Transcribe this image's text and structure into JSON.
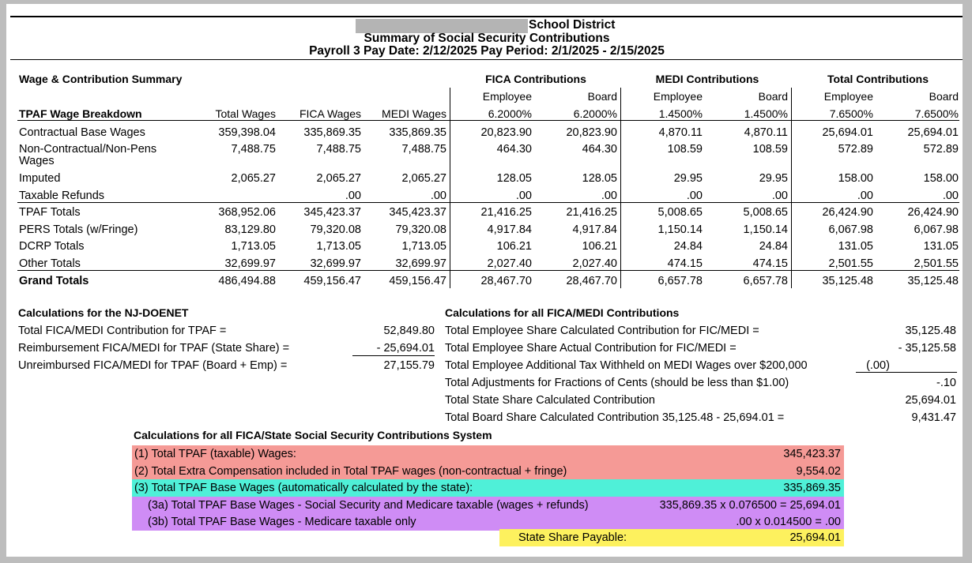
{
  "header": {
    "district_label": "School District",
    "title": "Summary of Social Security Contributions",
    "subtitle": "Payroll 3 Pay Date: 2/12/2025  Pay Period: 2/1/2025 - 2/15/2025"
  },
  "summary": {
    "section_title": "Wage & Contribution Summary",
    "group_fica": "FICA Contributions",
    "group_medi": "MEDI Contributions",
    "group_total": "Total Contributions",
    "sub_labels": [
      "Employee",
      "Board",
      "Employee",
      "Board",
      "Employee",
      "Board"
    ],
    "columns": [
      "TPAF Wage Breakdown",
      "Total Wages",
      "FICA Wages",
      "MEDI Wages",
      "6.2000%",
      "6.2000%",
      "1.4500%",
      "1.4500%",
      "7.6500%",
      "7.6500%"
    ],
    "rows": [
      {
        "label": "Contractual Base Wages",
        "v": [
          "359,398.04",
          "335,869.35",
          "335,869.35",
          "20,823.90",
          "20,823.90",
          "4,870.11",
          "4,870.11",
          "25,694.01",
          "25,694.01"
        ]
      },
      {
        "label": "Non-Contractual/Non-Pens",
        "label2": "Wages",
        "v": [
          "7,488.75",
          "7,488.75",
          "7,488.75",
          "464.30",
          "464.30",
          "108.59",
          "108.59",
          "572.89",
          "572.89"
        ]
      },
      {
        "label": "Imputed",
        "v": [
          "2,065.27",
          "2,065.27",
          "2,065.27",
          "128.05",
          "128.05",
          "29.95",
          "29.95",
          "158.00",
          "158.00"
        ]
      },
      {
        "label": "Taxable Refunds",
        "v": [
          "",
          ".00",
          ".00",
          ".00",
          ".00",
          ".00",
          ".00",
          ".00",
          ".00"
        ]
      },
      {
        "label": "TPAF Totals",
        "v": [
          "368,952.06",
          "345,423.37",
          "345,423.37",
          "21,416.25",
          "21,416.25",
          "5,008.65",
          "5,008.65",
          "26,424.90",
          "26,424.90"
        ]
      },
      {
        "label": "PERS Totals (w/Fringe)",
        "v": [
          "83,129.80",
          "79,320.08",
          "79,320.08",
          "4,917.84",
          "4,917.84",
          "1,150.14",
          "1,150.14",
          "6,067.98",
          "6,067.98"
        ]
      },
      {
        "label": "DCRP Totals",
        "v": [
          "1,713.05",
          "1,713.05",
          "1,713.05",
          "106.21",
          "106.21",
          "24.84",
          "24.84",
          "131.05",
          "131.05"
        ]
      },
      {
        "label": "Other Totals",
        "v": [
          "32,699.97",
          "32,699.97",
          "32,699.97",
          "2,027.40",
          "2,027.40",
          "474.15",
          "474.15",
          "2,501.55",
          "2,501.55"
        ]
      },
      {
        "label": "Grand Totals",
        "v": [
          "486,494.88",
          "459,156.47",
          "459,156.47",
          "28,467.70",
          "28,467.70",
          "6,657.78",
          "6,657.78",
          "35,125.48",
          "35,125.48"
        ]
      }
    ]
  },
  "doenet": {
    "title": "Calculations for the NJ-DOENET",
    "rows": [
      {
        "label": "Total FICA/MEDI Contribution for TPAF =",
        "value": "52,849.80"
      },
      {
        "label": "Reimbursement FICA/MEDI for TPAF (State Share) =",
        "value": "- 25,694.01"
      },
      {
        "label": "Unreimbursed FICA/MEDI for TPAF (Board + Emp) =",
        "value": "27,155.79"
      }
    ]
  },
  "fica_medi": {
    "title": "Calculations for all FICA/MEDI Contributions",
    "rows": [
      {
        "label": "Total Employee Share Calculated Contribution for FIC/MEDI =",
        "value": "35,125.48"
      },
      {
        "label": "Total Employee Share Actual Contribution for FIC/MEDI =",
        "value": "- 35,125.58"
      },
      {
        "label": "Total Employee Additional Tax Withheld on MEDI Wages over $200,000",
        "value": "(.00)"
      },
      {
        "label": "Total Adjustments for Fractions of Cents (should be less than $1.00)",
        "value": "-.10"
      },
      {
        "label": "Total State Share Calculated Contribution",
        "value": "25,694.01"
      },
      {
        "label": "Total Board Share Calculated Contribution  35,125.48 - 25,694.01 =",
        "value": "9,431.47"
      }
    ]
  },
  "state_ss": {
    "title": "Calculations for all FICA/State Social Security Contributions System",
    "rows": [
      {
        "label": "(1) Total TPAF (taxable) Wages:",
        "value": "345,423.37",
        "color": "#f59a96"
      },
      {
        "label": "(2) Total Extra Compensation included in Total TPAF wages (non-contractual + fringe)",
        "value": "9,554.02",
        "color": "#f59a96"
      },
      {
        "label": "(3) Total TPAF Base Wages (automatically calculated by the state):",
        "value": "335,869.35",
        "color": "#4ff0d8"
      },
      {
        "label": "(3a) Total TPAF Base Wages - Social Security and Medicare taxable (wages + refunds)",
        "value": "335,869.35   x 0.076500 =   25,694.01",
        "color": "#cf8cf5"
      },
      {
        "label": "(3b) Total TPAF Base Wages - Medicare taxable only",
        "value": ".00 x 0.014500 = .00",
        "color": "#cf8cf5"
      }
    ],
    "payable_label": "State Share Payable:",
    "payable_value": "25,694.01",
    "payable_color": "#fdf15e"
  }
}
